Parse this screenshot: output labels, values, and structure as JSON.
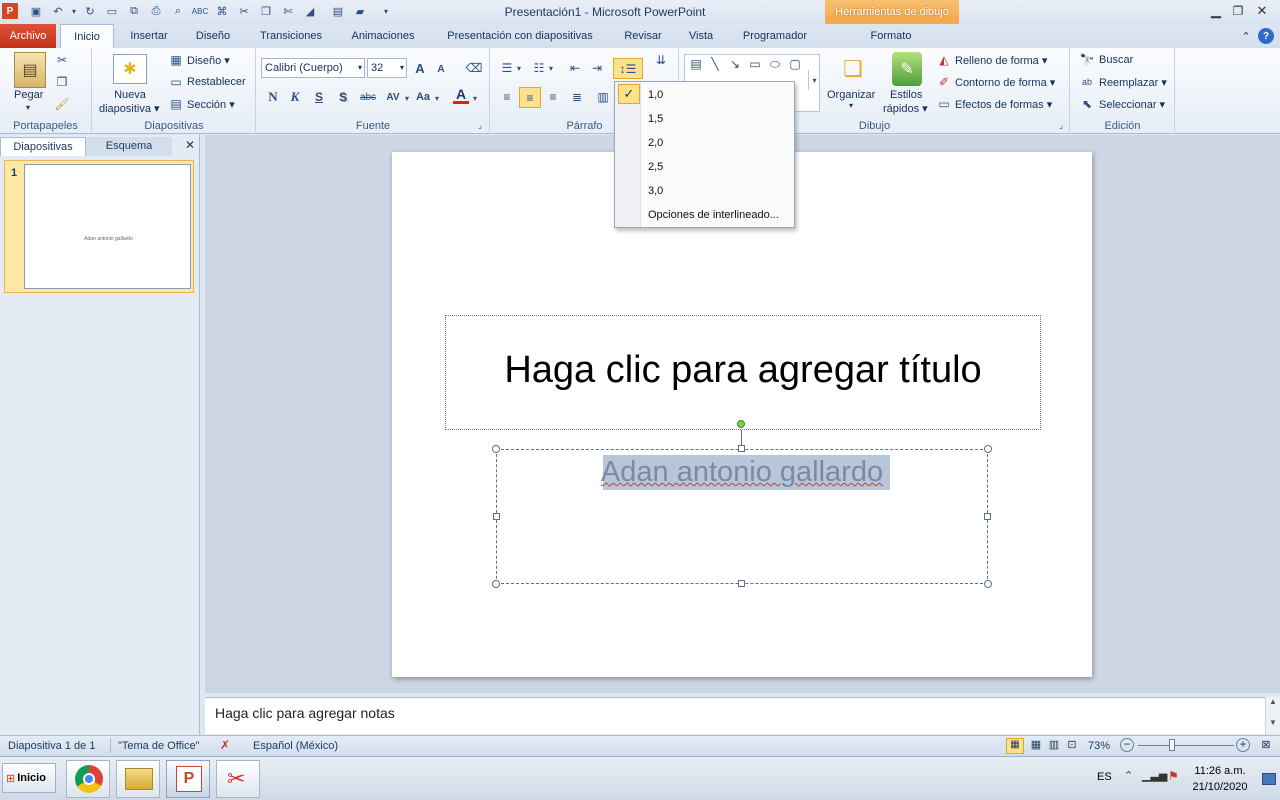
{
  "window": {
    "title": "Presentación1  -  Microsoft PowerPoint",
    "contextual_tab_header": "Herramientas de dibujo",
    "accent": "#f39b3f"
  },
  "tabs": [
    {
      "label": "Archivo"
    },
    {
      "label": "Inicio"
    },
    {
      "label": "Insertar"
    },
    {
      "label": "Diseño"
    },
    {
      "label": "Transiciones"
    },
    {
      "label": "Animaciones"
    },
    {
      "label": "Presentación con diapositivas"
    },
    {
      "label": "Revisar"
    },
    {
      "label": "Vista"
    },
    {
      "label": "Programador"
    },
    {
      "label": "Formato"
    }
  ],
  "ribbon": {
    "portapapeles": {
      "label": "Portapapeles",
      "pegar": "Pegar"
    },
    "diapositivas": {
      "label": "Diapositivas",
      "nueva_1": "Nueva",
      "nueva_2": "diapositiva ▾",
      "diseno": "Diseño ▾",
      "restablecer": "Restablecer",
      "seccion": "Sección ▾"
    },
    "fuente": {
      "label": "Fuente",
      "font_name": "Calibri (Cuerpo)",
      "font_size": "32",
      "bold": "N",
      "italic": "K",
      "underline": "S",
      "shadow": "S",
      "strike": "abc",
      "spacing": "AV",
      "case": "Aa",
      "color": "A",
      "grow": "A",
      "shrink": "A"
    },
    "parrafo": {
      "label": "Párrafo"
    },
    "dibujo": {
      "label": "Dibujo",
      "organizar": "Organizar",
      "estilos_1": "Estilos",
      "estilos_2": "rápidos ▾",
      "relleno": "Relleno de forma ▾",
      "contorno": "Contorno de forma ▾",
      "efectos": "Efectos de formas ▾"
    },
    "edicion": {
      "label": "Edición",
      "buscar": "Buscar",
      "reemplazar": "Reemplazar ▾",
      "seleccionar": "Seleccionar ▾"
    }
  },
  "line_spacing_menu": {
    "options": [
      "1,0",
      "1,5",
      "2,0",
      "2,5",
      "3,0"
    ],
    "selected": "1,0",
    "more": "Opciones de interlineado..."
  },
  "left_panel": {
    "tab_slides": "Diapositivas",
    "tab_outline": "Esquema",
    "slide_number": "1",
    "thumb_text": "Adan antonio gallardo"
  },
  "slide": {
    "title_placeholder": "Haga clic para agregar título",
    "subtitle_text": "Adan antonio gallardo"
  },
  "notes_placeholder": "Haga clic para agregar notas",
  "status": {
    "slide_info": "Diapositiva 1 de 1",
    "theme": "\"Tema de Office\"",
    "language": "Español (México)",
    "zoom": "73%",
    "zoom_fraction": 0.73
  },
  "taskbar": {
    "start": "Inicio",
    "lang": "ES",
    "time": "11:26 a.m.",
    "date": "21/10/2020"
  }
}
